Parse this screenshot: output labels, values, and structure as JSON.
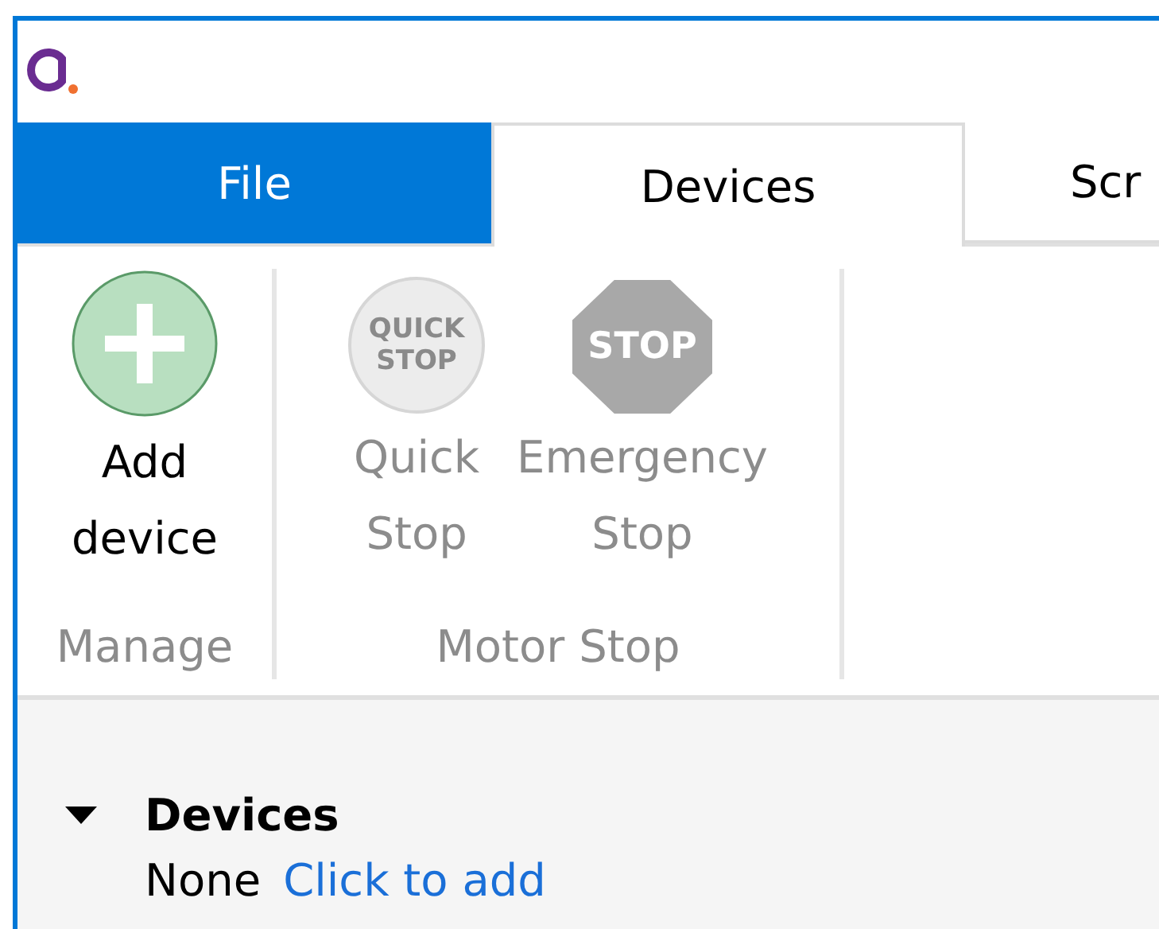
{
  "tabs": [
    {
      "label": "File",
      "kind": "file",
      "selected": false
    },
    {
      "label": "Devices",
      "kind": "tab",
      "selected": true
    },
    {
      "label": "Scr",
      "kind": "tab",
      "selected": false
    }
  ],
  "ribbon_groups": [
    {
      "label": "Manage",
      "buttons": [
        {
          "label": [
            "Add",
            "device"
          ],
          "kind": "add",
          "disabled": false
        }
      ]
    },
    {
      "label": "Motor Stop",
      "buttons": [
        {
          "label": [
            "Quick",
            "Stop"
          ],
          "kind": "quick-stop",
          "icon_text": [
            "QUICK",
            "STOP"
          ],
          "disabled": true
        },
        {
          "label": [
            "Emergency",
            "Stop"
          ],
          "kind": "emergency-stop",
          "icon_text": [
            "STOP"
          ],
          "disabled": true
        }
      ]
    }
  ],
  "section": {
    "title": "Devices",
    "expanded": true,
    "empty_text": "None",
    "link": "Click to add"
  }
}
